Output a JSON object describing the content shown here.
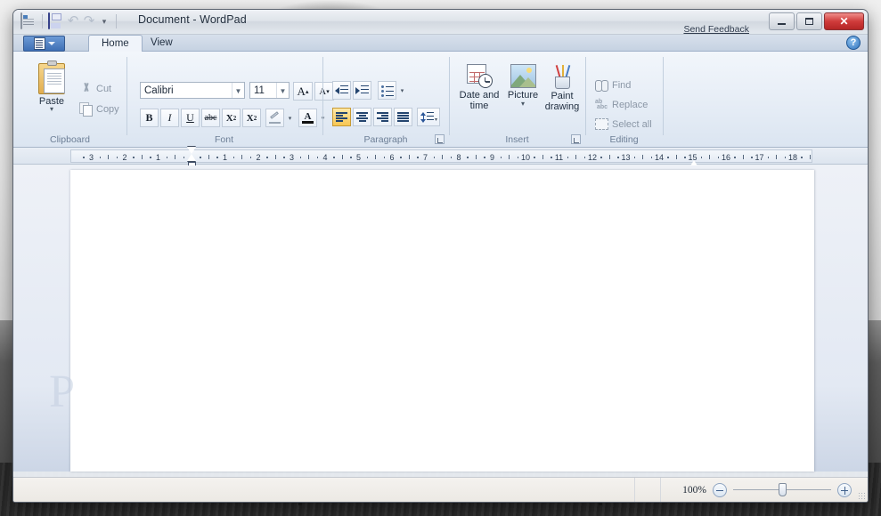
{
  "window": {
    "title": "Document - WordPad",
    "feedback_link": "Send Feedback",
    "buttons": {
      "minimize": "minimize-icon",
      "maximize": "maximize-icon",
      "close": "✕"
    }
  },
  "quick_access": {
    "app_icon": "wordpad-icon",
    "save": "save-icon",
    "undo": "↶",
    "redo": "↷",
    "customize": "▾"
  },
  "tabs": [
    {
      "label": "Home",
      "active": true
    },
    {
      "label": "View",
      "active": false
    }
  ],
  "app_button": {
    "label": "file-menu",
    "caret": "▾"
  },
  "help": {
    "icon": "help-icon",
    "glyph": "?"
  },
  "ribbon": {
    "groups": [
      {
        "name": "Clipboard",
        "label": "Clipboard",
        "paste": "Paste",
        "paste_caret": "▾",
        "cut": "Cut",
        "copy": "Copy"
      },
      {
        "name": "Font",
        "label": "Font",
        "font_family": "Calibri",
        "font_size": "11",
        "grow_font": "A",
        "shrink_font": "A",
        "bold": "B",
        "italic": "I",
        "underline": "U",
        "strikethrough": "abc",
        "subscript": "X",
        "subscript_sub": "2",
        "superscript": "X",
        "superscript_sup": "2",
        "highlight": "highlight-icon",
        "text_color": "A",
        "caret": "▾"
      },
      {
        "name": "Paragraph",
        "label": "Paragraph",
        "decrease_indent": "decrease-indent-icon",
        "increase_indent": "increase-indent-icon",
        "bullets": "bullets-icon",
        "align_left": "align-left-icon",
        "align_center": "align-center-icon",
        "align_right": "align-right-icon",
        "justify": "justify-icon",
        "line_spacing": "line-spacing-icon",
        "caret": "▾",
        "dialog_launcher": "paragraph-dialog-launcher"
      },
      {
        "name": "Insert",
        "label": "Insert",
        "date_and_time": "Date and\ntime",
        "date_and_time_line1": "Date and",
        "date_and_time_line2": "time",
        "picture": "Picture",
        "picture_caret": "▾",
        "paint_drawing_line1": "Paint",
        "paint_drawing_line2": "drawing",
        "dialog_launcher": "insert-dialog-launcher"
      },
      {
        "name": "Editing",
        "label": "Editing",
        "find": "Find",
        "replace": "Replace",
        "select_all": "Select all"
      }
    ]
  },
  "ruler": {
    "left_labels": [
      "3",
      "2",
      "1"
    ],
    "right_labels": [
      "1",
      "2",
      "3",
      "4",
      "5",
      "6",
      "7",
      "8",
      "9",
      "10",
      "11",
      "12",
      "13",
      "14",
      "15",
      "16",
      "17",
      "18"
    ],
    "left_indent_marker": "left-indent-marker",
    "right_indent_marker": "right-indent-marker"
  },
  "document": {
    "content": "",
    "watermark": "P"
  },
  "status_bar": {
    "zoom_percent": "100%",
    "zoom_out": "zoom-out-button",
    "zoom_in": "zoom-in-button",
    "slider_value": 50
  },
  "colors": {
    "accent": "#4a7ebb",
    "ribbon_bg": "#e6edf6",
    "title_bg": "#dfe4ea",
    "close_red": "#cf3b3b",
    "highlight_yellow": "#f7c653",
    "page_white": "#ffffff"
  }
}
